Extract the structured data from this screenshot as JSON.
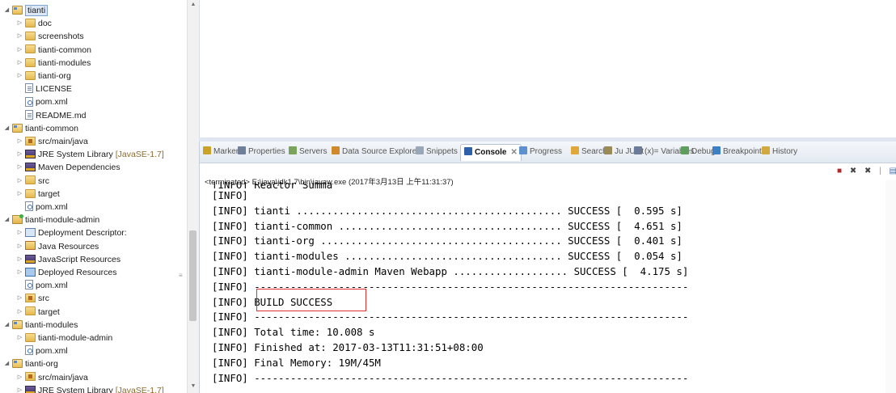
{
  "tree": {
    "items": [
      {
        "label": "tianti",
        "icon": "project-icon",
        "depth": 0,
        "toggle": "expanded",
        "selected": true
      },
      {
        "label": "doc",
        "icon": "folder-icon",
        "depth": 1,
        "toggle": "collapsed"
      },
      {
        "label": "screenshots",
        "icon": "folder-icon",
        "depth": 1,
        "toggle": "collapsed"
      },
      {
        "label": "tianti-common",
        "icon": "folder-icon",
        "depth": 1,
        "toggle": "collapsed"
      },
      {
        "label": "tianti-modules",
        "icon": "folder-icon",
        "depth": 1,
        "toggle": "collapsed"
      },
      {
        "label": "tianti-org",
        "icon": "folder-icon",
        "depth": 1,
        "toggle": "collapsed"
      },
      {
        "label": "LICENSE",
        "icon": "file-icon",
        "depth": 1,
        "toggle": "none"
      },
      {
        "label": "pom.xml",
        "icon": "xml-file-icon",
        "depth": 1,
        "toggle": "none"
      },
      {
        "label": "README.md",
        "icon": "file-icon",
        "depth": 1,
        "toggle": "none"
      },
      {
        "label": "tianti-common",
        "icon": "maven-project-icon",
        "depth": 0,
        "toggle": "expanded"
      },
      {
        "label": "src/main/java",
        "icon": "source-folder-icon",
        "depth": 1,
        "toggle": "collapsed"
      },
      {
        "label": "JRE System Library",
        "suffix": "[JavaSE-1.7]",
        "icon": "library-icon",
        "depth": 1,
        "toggle": "collapsed"
      },
      {
        "label": "Maven Dependencies",
        "icon": "library-icon",
        "depth": 1,
        "toggle": "collapsed"
      },
      {
        "label": "src",
        "icon": "folder-icon",
        "depth": 1,
        "toggle": "collapsed"
      },
      {
        "label": "target",
        "icon": "folder-icon",
        "depth": 1,
        "toggle": "collapsed"
      },
      {
        "label": "pom.xml",
        "icon": "xml-file-icon",
        "depth": 1,
        "toggle": "none"
      },
      {
        "label": "tianti-module-admin",
        "icon": "web-project-icon",
        "depth": 0,
        "toggle": "expanded"
      },
      {
        "label": "Deployment Descriptor:",
        "icon": "deployment-descriptor-icon",
        "depth": 1,
        "toggle": "collapsed"
      },
      {
        "label": "Java Resources",
        "icon": "java-resources-icon",
        "depth": 1,
        "toggle": "collapsed"
      },
      {
        "label": "JavaScript Resources",
        "icon": "library-icon",
        "depth": 1,
        "toggle": "collapsed"
      },
      {
        "label": "Deployed Resources",
        "icon": "deployed-resources-icon",
        "depth": 1,
        "toggle": "collapsed"
      },
      {
        "label": "pom.xml",
        "icon": "xml-file-icon",
        "depth": 1,
        "toggle": "none"
      },
      {
        "label": "src",
        "icon": "source-folder-icon",
        "depth": 1,
        "toggle": "collapsed"
      },
      {
        "label": "target",
        "icon": "folder-icon",
        "depth": 1,
        "toggle": "collapsed"
      },
      {
        "label": "tianti-modules",
        "icon": "maven-project-icon",
        "depth": 0,
        "toggle": "expanded"
      },
      {
        "label": "tianti-module-admin",
        "icon": "folder-icon",
        "depth": 1,
        "toggle": "collapsed"
      },
      {
        "label": "pom.xml",
        "icon": "xml-file-icon",
        "depth": 1,
        "toggle": "none"
      },
      {
        "label": "tianti-org",
        "icon": "maven-project-icon",
        "depth": 0,
        "toggle": "expanded"
      },
      {
        "label": "src/main/java",
        "icon": "source-folder-icon",
        "depth": 1,
        "toggle": "collapsed"
      },
      {
        "label": "JRE System Library",
        "suffix": "[JavaSE-1.7]",
        "icon": "library-icon",
        "depth": 1,
        "toggle": "collapsed"
      }
    ]
  },
  "views": {
    "tabs": [
      {
        "label": "Markers",
        "icon": "markers-icon",
        "color": "#c9a227"
      },
      {
        "label": "Properties",
        "icon": "properties-icon",
        "color": "#6f7f99"
      },
      {
        "label": "Servers",
        "icon": "servers-icon",
        "color": "#7aa35b"
      },
      {
        "label": "Data Source Explorer",
        "icon": "data-source-icon",
        "color": "#d08a2a"
      },
      {
        "label": "Snippets",
        "icon": "snippets-icon",
        "color": "#9aa7b8"
      },
      {
        "label": "Console",
        "icon": "console-icon",
        "color": "#2f5fa8",
        "active": true,
        "close": "✕"
      },
      {
        "label": "Progress",
        "icon": "progress-icon",
        "color": "#5e8fcf"
      },
      {
        "label": "Search",
        "icon": "search-icon",
        "color": "#e0a83a"
      },
      {
        "label": "JUnit",
        "prefix": "Ju",
        "icon": "junit-icon",
        "color": "#9a8a55"
      },
      {
        "label": "Variables",
        "prefix": "(x)=",
        "icon": "variables-icon",
        "color": "#6d7b9b"
      },
      {
        "label": "Debug",
        "icon": "debug-icon",
        "color": "#5d9d5d"
      },
      {
        "label": "Breakpoints",
        "icon": "breakpoints-icon",
        "color": "#3b7fc4"
      },
      {
        "label": "History",
        "icon": "history-icon",
        "color": "#d1a93e"
      }
    ],
    "toolbar": [
      "terminate-icon",
      "remove-launch-icon",
      "remove-all-terminated-icon",
      "scroll-lock-icon"
    ]
  },
  "console": {
    "terminated_line": "<terminated> E:\\java\\jdk1.7\\bin\\javaw.exe (2017年3月13日 上午11:31:37)",
    "clipped_line": "[INFO] Reactor Summary:",
    "lines": [
      "[INFO]",
      "[INFO] tianti ............................................ SUCCESS [  0.595 s]",
      "[INFO] tianti-common ..................................... SUCCESS [  4.651 s]",
      "[INFO] tianti-org ........................................ SUCCESS [  0.401 s]",
      "[INFO] tianti-modules .................................... SUCCESS [  0.054 s]",
      "[INFO] tianti-module-admin Maven Webapp ................... SUCCESS [  4.175 s]",
      "[INFO] ------------------------------------------------------------------------",
      "[INFO] BUILD SUCCESS",
      "[INFO] ------------------------------------------------------------------------",
      "[INFO] Total time: 10.008 s",
      "[INFO] Finished at: 2017-03-13T11:31:51+08:00",
      "[INFO] Final Memory: 19M/45M",
      "[INFO] ------------------------------------------------------------------------"
    ],
    "highlight_color": "#e03030"
  }
}
